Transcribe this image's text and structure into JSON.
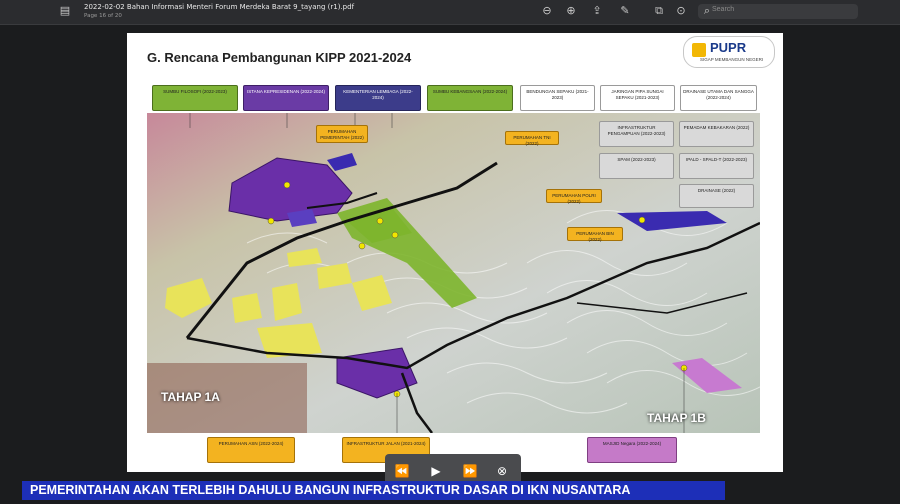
{
  "toolbar": {
    "doc_title": "2022-02-02 Bahan Informasi Menteri Forum Merdeka Barat 9_tayang (r1).pdf",
    "page_info": "Page 16 of 20",
    "search_placeholder": "Search"
  },
  "slide": {
    "title": "G. Rencana Pembangunan KIPP 2021-2024",
    "logo_text": "PUPR",
    "logo_sub": "SIGAP MEMBANGUN NEGERI",
    "labels_top": [
      {
        "text": "SUMBU FILOSOFI (2022-2023)",
        "style": "green"
      },
      {
        "text": "ISTANA KEPRESIDENAN (2022-2024)",
        "style": "purple"
      },
      {
        "text": "KEMENTERIAN LEMBAGA (2022-2024)",
        "style": "navy"
      },
      {
        "text": "SUMBU KEBANGSAAN (2022-2024)",
        "style": "green"
      },
      {
        "text": "BENDUNGAN SEPAKU (2021-2023)",
        "style": "white"
      },
      {
        "text": "JARINGAN PIPA SUNGAI SEPAKU (2021-2023)",
        "style": "white"
      },
      {
        "text": "DRAINASE UTAMA DAN SANGGA (2022-2024)",
        "style": "white"
      }
    ],
    "labels_right": [
      {
        "text": "INFRASTRUKTUR PENGAMPUAN (2022-2023)",
        "style": "grey"
      },
      {
        "text": "PEMADAM KEBAKARAN (2022)",
        "style": "grey"
      },
      {
        "text": "SPAM (2022-2023)",
        "style": "grey"
      },
      {
        "text": "IPALD - SPALD-T (2022-2023)",
        "style": "grey"
      },
      {
        "text": "DRAINASE (2022)",
        "style": "grey"
      }
    ],
    "labels_map": [
      {
        "text": "PERUMAHAN PEMERINTAH (2022)",
        "style": "orange"
      },
      {
        "text": "PERUMAHAN TNI (2022)",
        "style": "orange"
      },
      {
        "text": "PERUMAHAN POLRI (2022)",
        "style": "orange"
      },
      {
        "text": "PERUMAHAN BIN (2022)",
        "style": "orange"
      }
    ],
    "labels_bottom": [
      {
        "text": "PERUMAHAN ASN (2022-2024)",
        "style": "orange"
      },
      {
        "text": "INFRASTRUKTUR JALAN (2021-2024)",
        "style": "orange"
      },
      {
        "text": "MASJID Negara (2022-2024)",
        "style": "pink"
      }
    ],
    "tahap_1a": "TAHAP 1A",
    "tahap_1b": "TAHAP 1B"
  },
  "controls": {
    "prev": "⏪",
    "play": "▶",
    "next": "⏩",
    "close": "⊗"
  },
  "caption": "PEMERINTAHAN AKAN TERLEBIH DAHULU BANGUN INFRASTRUKTUR DASAR DI IKN NUSANTARA"
}
